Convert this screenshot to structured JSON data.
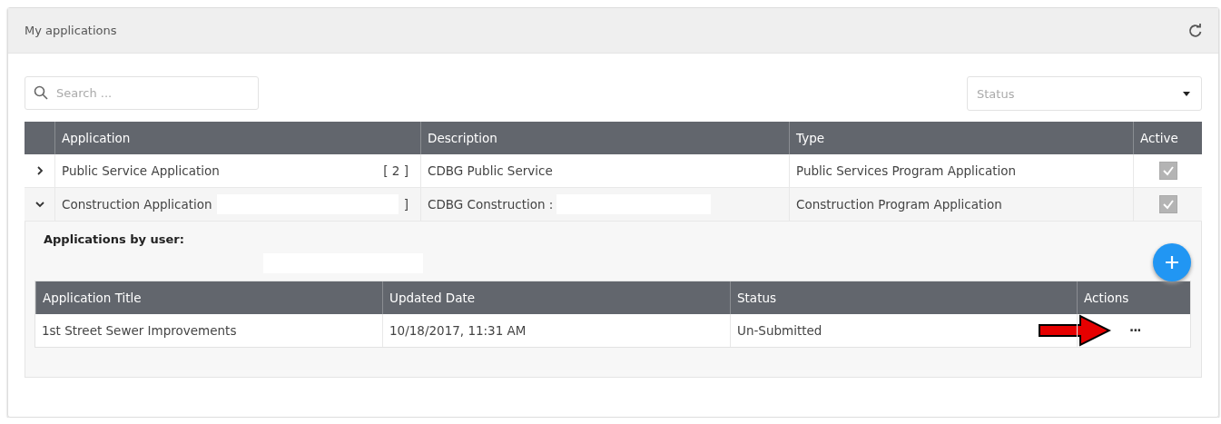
{
  "panel": {
    "title": "My applications"
  },
  "search": {
    "placeholder": "Search ..."
  },
  "status_filter": {
    "placeholder": "Status"
  },
  "table": {
    "columns": [
      "Application",
      "Description",
      "Type",
      "Active"
    ],
    "rows": [
      {
        "expanded": false,
        "application": "Public Service Application",
        "count": "[ 2 ]",
        "description": "CDBG Public Service",
        "type": "Public Services Program Application",
        "active": true
      },
      {
        "expanded": true,
        "application": "Construction Application",
        "count": "]",
        "description": "CDBG Construction :",
        "type": "Construction Program Application",
        "active": true,
        "details": {
          "heading": "Applications by user:",
          "columns": [
            "Application Title",
            "Updated Date",
            "Status",
            "Actions"
          ],
          "rows": [
            {
              "title": "1st Street Sewer Improvements",
              "updated": "10/18/2017, 11:31 AM",
              "status": "Un-Submitted",
              "actions": "···"
            }
          ]
        }
      }
    ]
  }
}
